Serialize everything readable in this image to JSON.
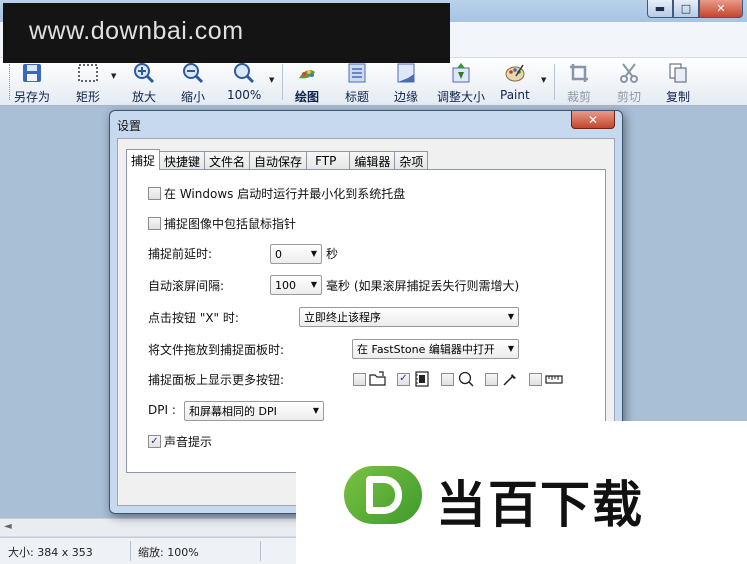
{
  "app": {
    "window_controls": {
      "minimize": "▬",
      "maximize": "□",
      "close": "✕"
    }
  },
  "watermark_top": "www.downbai.com",
  "watermark_bottom": "当百下载",
  "toolbar": {
    "items": [
      {
        "label": "另存为",
        "icon": "save-icon",
        "disabled": false
      },
      {
        "label": "矩形",
        "icon": "rectangle-select-icon",
        "disabled": false
      },
      {
        "label": "放大",
        "icon": "zoom-in-icon",
        "disabled": false
      },
      {
        "label": "缩小",
        "icon": "zoom-out-icon",
        "disabled": false
      },
      {
        "label": "100%",
        "icon": "zoom-actual-icon",
        "disabled": false
      },
      {
        "label": "绘图",
        "icon": "draw-icon",
        "disabled": false
      },
      {
        "label": "标题",
        "icon": "caption-icon",
        "disabled": false
      },
      {
        "label": "边缘",
        "icon": "edge-icon",
        "disabled": false
      },
      {
        "label": "调整大小",
        "icon": "resize-icon",
        "disabled": false
      },
      {
        "label": "Paint",
        "icon": "paint-icon",
        "disabled": false
      },
      {
        "label": "裁剪",
        "icon": "crop-icon",
        "disabled": true
      },
      {
        "label": "剪切",
        "icon": "cut-icon",
        "disabled": true
      },
      {
        "label": "复制",
        "icon": "copy-icon",
        "disabled": false
      }
    ]
  },
  "statusbar": {
    "size": "大小: 384 x 353",
    "zoom": "缩放: 100%"
  },
  "dialog": {
    "title": "设置",
    "close": "✕",
    "tabs": [
      "捕捉",
      "快捷键",
      "文件名",
      "自动保存",
      "FTP",
      "编辑器",
      "杂项"
    ],
    "active_tab": "捕捉",
    "options": {
      "startup_label": "在 Windows 启动时运行并最小化到系统托盘",
      "startup_checked": false,
      "include_cursor_label": "捕捉图像中包括鼠标指针",
      "include_cursor_checked": false,
      "delay_label": "捕捉前延时:",
      "delay_value": "0",
      "delay_unit": "秒",
      "scroll_label": "自动滚屏间隔:",
      "scroll_value": "100",
      "scroll_unit": "毫秒 (如果滚屏捕捉丢失行则需增大)",
      "x_label": "点击按钮 \"X\" 时:",
      "x_value": "立即终止该程序",
      "drop_label": "将文件拖放到捕捉面板时:",
      "drop_value": "在 FastStone 编辑器中打开",
      "more_buttons_label": "捕捉面板上显示更多按钮:",
      "more_buttons": [
        {
          "icon": "open-folder-icon",
          "checked": false
        },
        {
          "icon": "film-icon",
          "checked": true
        },
        {
          "icon": "magnifier-icon",
          "checked": false
        },
        {
          "icon": "color-picker-icon",
          "checked": false
        },
        {
          "icon": "ruler-icon",
          "checked": false
        }
      ],
      "dpi_label": "DPI :",
      "dpi_value": "和屏幕相同的 DPI",
      "sound_label": "声音提示",
      "sound_checked": true
    }
  },
  "check_glyph": "✓",
  "dropdown_glyph": "▼",
  "scroll_left_glyph": "◄"
}
